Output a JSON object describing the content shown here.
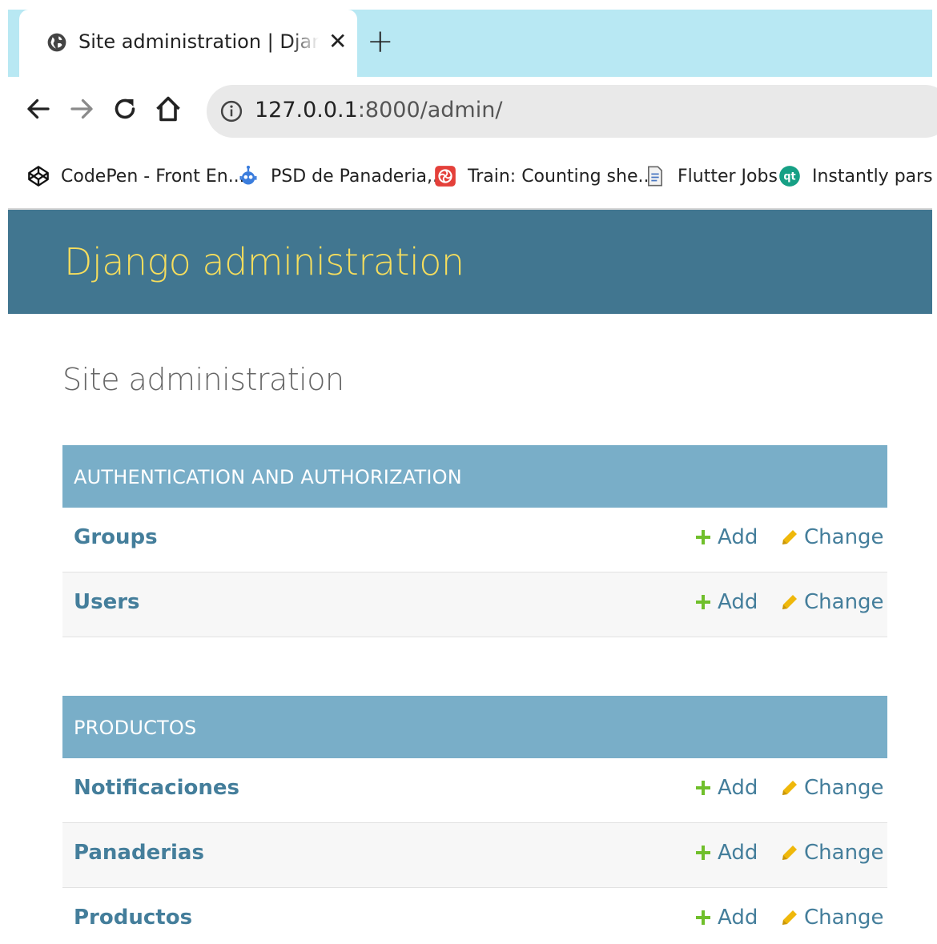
{
  "browser": {
    "tab_title": "Site administration | Django site admin",
    "tab_close": "✕",
    "new_tab": "+",
    "url_host": "127.0.0.1",
    "url_rest": ":8000/admin/",
    "bookmarks": [
      {
        "label": "CodePen - Front En...",
        "icon": "codepen-icon"
      },
      {
        "label": "PSD de Panaderia,...",
        "icon": "robot-icon"
      },
      {
        "label": "Train: Counting she...",
        "icon": "swirl-icon"
      },
      {
        "label": "Flutter Jobs",
        "icon": "document-icon"
      },
      {
        "label": "Instantly parse JSON",
        "icon": "qt-icon"
      }
    ]
  },
  "admin": {
    "brand": "Django administration",
    "page_title": "Site administration",
    "modules": [
      {
        "caption": "Authentication and Authorization",
        "rows": [
          {
            "model": "Groups",
            "add": "Add",
            "change": "Change"
          },
          {
            "model": "Users",
            "add": "Add",
            "change": "Change"
          }
        ]
      },
      {
        "caption": "Productos",
        "rows": [
          {
            "model": "Notificaciones",
            "add": "Add",
            "change": "Change"
          },
          {
            "model": "Panaderias",
            "add": "Add",
            "change": "Change"
          },
          {
            "model": "Productos",
            "add": "Add",
            "change": "Change"
          }
        ]
      }
    ]
  },
  "colors": {
    "header_bg": "#417690",
    "brand_text": "#f5dd5d",
    "module_caption_bg": "#79aec8",
    "link": "#447e9b",
    "add_icon": "#70bf2b",
    "change_icon": "#efb80b",
    "tabstrip_bg": "#b8e8f3"
  }
}
